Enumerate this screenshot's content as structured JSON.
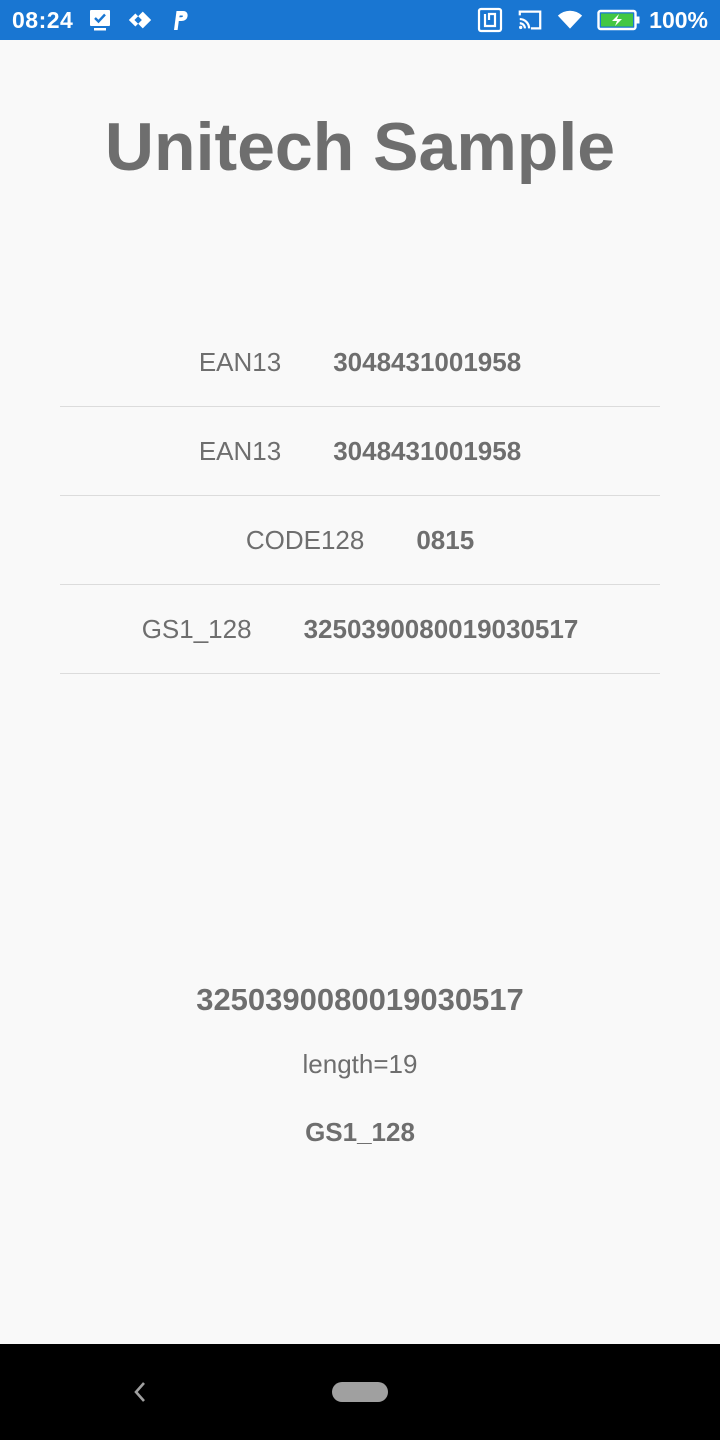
{
  "status_bar": {
    "time": "08:24",
    "battery_percent": "100%",
    "left_icons": [
      "screen-check-icon",
      "diamond-arrows-icon",
      "parking-icon"
    ],
    "right_icons": [
      "nfc-icon",
      "cast-icon",
      "wifi-icon",
      "battery-charging-icon"
    ],
    "background": "#1976d2"
  },
  "app": {
    "title": "Unitech Sample"
  },
  "scans": [
    {
      "type": "EAN13",
      "value": "3048431001958"
    },
    {
      "type": "EAN13",
      "value": "3048431001958"
    },
    {
      "type": "CODE128",
      "value": "0815"
    },
    {
      "type": "GS1_128",
      "value": "3250390080019030517"
    }
  ],
  "result": {
    "barcode": "3250390080019030517",
    "length": "length=19",
    "type": "GS1_128"
  },
  "nav_bar": {
    "icons": [
      "back-icon",
      "home-pill-icon"
    ]
  }
}
